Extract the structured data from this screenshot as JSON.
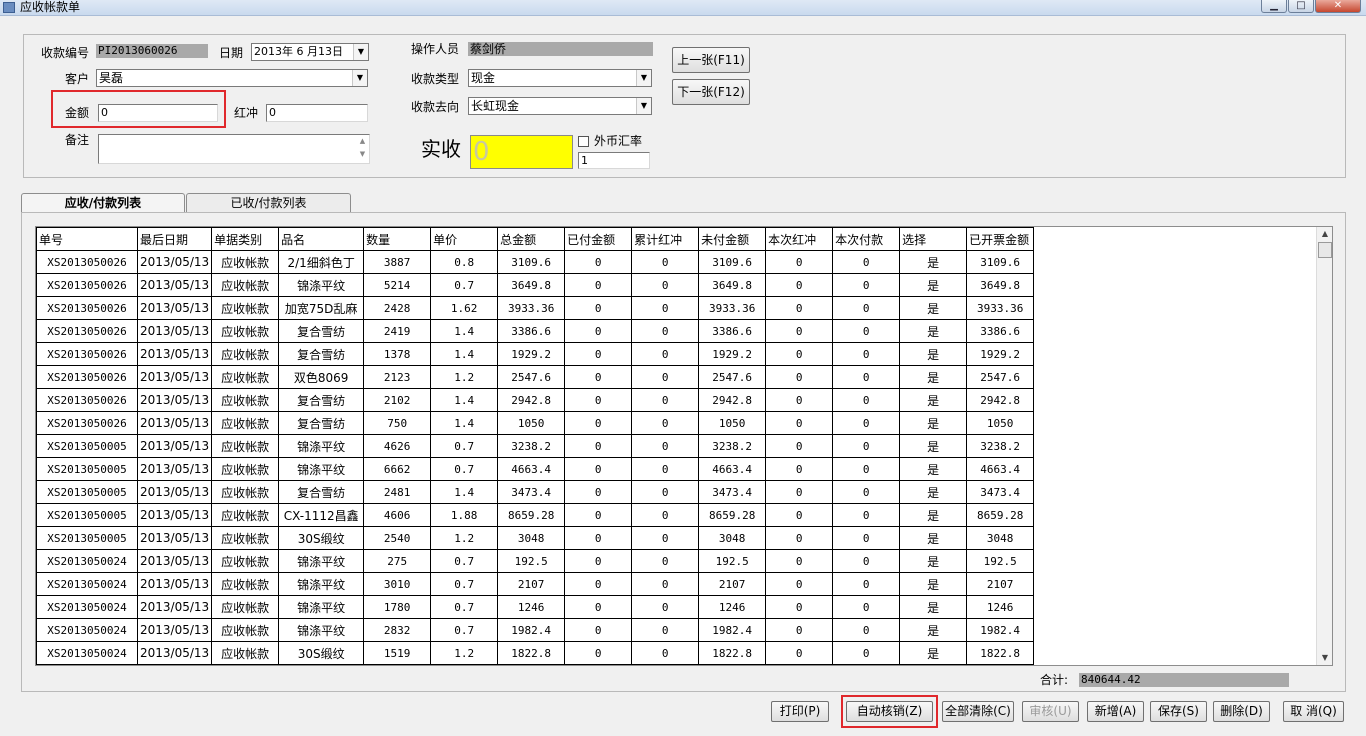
{
  "window": {
    "title": "应收帐款单"
  },
  "form": {
    "receipt_no_label": "收款编号",
    "receipt_no": "PI2013060026",
    "date_label": "日期",
    "date": "2013年 6 月13日",
    "customer_label": "客户",
    "customer": "昊磊",
    "amount_label": "金额",
    "amount": "0",
    "offset_label": "红冲",
    "offset": "0",
    "note_label": "备注",
    "note": "",
    "operator_label": "操作人员",
    "operator": "蔡剑侨",
    "receipt_type_label": "收款类型",
    "receipt_type": "现金",
    "receipt_dest_label": "收款去向",
    "receipt_dest": "长虹现金",
    "actual_label": "实收",
    "actual": "0",
    "fx_label": "外币汇率",
    "fx_rate": "1",
    "prev_button": "上一张(F11)",
    "next_button": "下一张(F12)"
  },
  "tabs": [
    {
      "label": "应收/付款列表",
      "active": true
    },
    {
      "label": "已收/付款列表",
      "active": false
    }
  ],
  "grid": {
    "columns": [
      "单号",
      "最后日期",
      "单据类别",
      "品名",
      "数量",
      "单价",
      "总金额",
      "已付金额",
      "累计红冲",
      "未付金额",
      "本次红冲",
      "本次付款",
      "选择",
      "已开票金额"
    ],
    "rows": [
      [
        "XS2013050026",
        "2013/05/13",
        "应收帐款",
        "2/1细斜色丁",
        "3887",
        "0.8",
        "3109.6",
        "0",
        "0",
        "3109.6",
        "0",
        "0",
        "是",
        "3109.6"
      ],
      [
        "XS2013050026",
        "2013/05/13",
        "应收帐款",
        "锦涤平纹",
        "5214",
        "0.7",
        "3649.8",
        "0",
        "0",
        "3649.8",
        "0",
        "0",
        "是",
        "3649.8"
      ],
      [
        "XS2013050026",
        "2013/05/13",
        "应收帐款",
        "加宽75D乱麻",
        "2428",
        "1.62",
        "3933.36",
        "0",
        "0",
        "3933.36",
        "0",
        "0",
        "是",
        "3933.36"
      ],
      [
        "XS2013050026",
        "2013/05/13",
        "应收帐款",
        "复合雪纺",
        "2419",
        "1.4",
        "3386.6",
        "0",
        "0",
        "3386.6",
        "0",
        "0",
        "是",
        "3386.6"
      ],
      [
        "XS2013050026",
        "2013/05/13",
        "应收帐款",
        "复合雪纺",
        "1378",
        "1.4",
        "1929.2",
        "0",
        "0",
        "1929.2",
        "0",
        "0",
        "是",
        "1929.2"
      ],
      [
        "XS2013050026",
        "2013/05/13",
        "应收帐款",
        "双色8069",
        "2123",
        "1.2",
        "2547.6",
        "0",
        "0",
        "2547.6",
        "0",
        "0",
        "是",
        "2547.6"
      ],
      [
        "XS2013050026",
        "2013/05/13",
        "应收帐款",
        "复合雪纺",
        "2102",
        "1.4",
        "2942.8",
        "0",
        "0",
        "2942.8",
        "0",
        "0",
        "是",
        "2942.8"
      ],
      [
        "XS2013050026",
        "2013/05/13",
        "应收帐款",
        "复合雪纺",
        "750",
        "1.4",
        "1050",
        "0",
        "0",
        "1050",
        "0",
        "0",
        "是",
        "1050"
      ],
      [
        "XS2013050005",
        "2013/05/13",
        "应收帐款",
        "锦涤平纹",
        "4626",
        "0.7",
        "3238.2",
        "0",
        "0",
        "3238.2",
        "0",
        "0",
        "是",
        "3238.2"
      ],
      [
        "XS2013050005",
        "2013/05/13",
        "应收帐款",
        "锦涤平纹",
        "6662",
        "0.7",
        "4663.4",
        "0",
        "0",
        "4663.4",
        "0",
        "0",
        "是",
        "4663.4"
      ],
      [
        "XS2013050005",
        "2013/05/13",
        "应收帐款",
        "复合雪纺",
        "2481",
        "1.4",
        "3473.4",
        "0",
        "0",
        "3473.4",
        "0",
        "0",
        "是",
        "3473.4"
      ],
      [
        "XS2013050005",
        "2013/05/13",
        "应收帐款",
        "CX-1112昌鑫",
        "4606",
        "1.88",
        "8659.28",
        "0",
        "0",
        "8659.28",
        "0",
        "0",
        "是",
        "8659.28"
      ],
      [
        "XS2013050005",
        "2013/05/13",
        "应收帐款",
        "30S缎纹",
        "2540",
        "1.2",
        "3048",
        "0",
        "0",
        "3048",
        "0",
        "0",
        "是",
        "3048"
      ],
      [
        "XS2013050024",
        "2013/05/13",
        "应收帐款",
        "锦涤平纹",
        "275",
        "0.7",
        "192.5",
        "0",
        "0",
        "192.5",
        "0",
        "0",
        "是",
        "192.5"
      ],
      [
        "XS2013050024",
        "2013/05/13",
        "应收帐款",
        "锦涤平纹",
        "3010",
        "0.7",
        "2107",
        "0",
        "0",
        "2107",
        "0",
        "0",
        "是",
        "2107"
      ],
      [
        "XS2013050024",
        "2013/05/13",
        "应收帐款",
        "锦涤平纹",
        "1780",
        "0.7",
        "1246",
        "0",
        "0",
        "1246",
        "0",
        "0",
        "是",
        "1246"
      ],
      [
        "XS2013050024",
        "2013/05/13",
        "应收帐款",
        "锦涤平纹",
        "2832",
        "0.7",
        "1982.4",
        "0",
        "0",
        "1982.4",
        "0",
        "0",
        "是",
        "1982.4"
      ],
      [
        "XS2013050024",
        "2013/05/13",
        "应收帐款",
        "30S缎纹",
        "1519",
        "1.2",
        "1822.8",
        "0",
        "0",
        "1822.8",
        "0",
        "0",
        "是",
        "1822.8"
      ],
      [
        "",
        "",
        "",
        "",
        "",
        "",
        "",
        "",
        "",
        "",
        "",
        "",
        "",
        ""
      ]
    ]
  },
  "total": {
    "label": "合计:",
    "value": "840644.42"
  },
  "actions": {
    "print": "打印(P)",
    "auto_writeoff": "自动核销(Z)",
    "clear_all": "全部清除(C)",
    "review": "审核(U)",
    "add": "新增(A)",
    "save": "保存(S)",
    "delete": "删除(D)",
    "cancel": "取 消(Q)"
  },
  "colors": {
    "highlight": "#ffff00",
    "callout": "#e0282c",
    "readonly": "#a9a9a9",
    "actual_text": "#c8c8a0"
  }
}
